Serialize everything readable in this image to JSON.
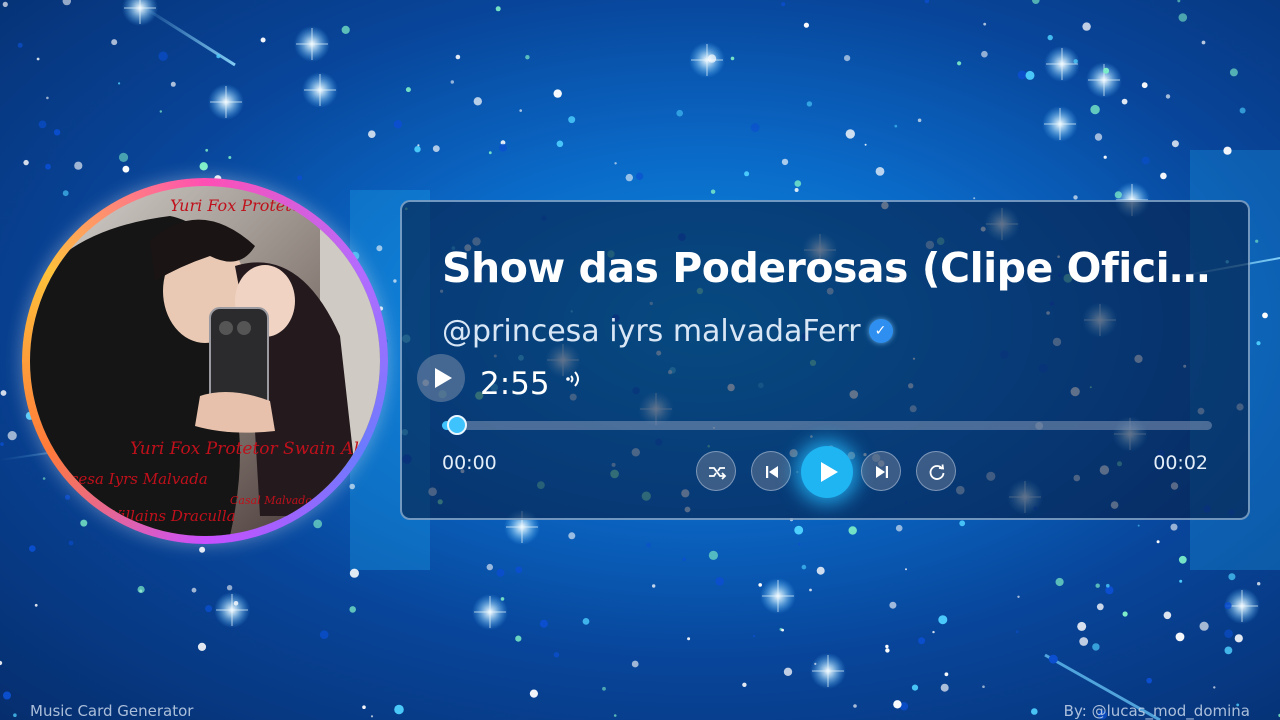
{
  "track": {
    "title": "Show das Poderosas (Clipe Oficial...",
    "artist": "@princesa iyrs malvadaFerr",
    "verified_icon": "✓",
    "duration": "2:55",
    "current_time": "00:00",
    "end_time": "00:02",
    "progress": 0.02
  },
  "icons": {
    "mini_play": "play-icon",
    "volume": "volume-icon",
    "shuffle": "shuffle-icon",
    "previous": "skip-previous-icon",
    "play": "play-icon",
    "next": "skip-next-icon",
    "repeat": "repeat-icon",
    "verified": "verified-badge-icon"
  },
  "colors": {
    "accent": "#3ec3ff",
    "play_button": "#1fb4f2",
    "verified": "#2e8ff0"
  },
  "footer": {
    "left": "Music Card Generator",
    "right": "By: @lucas_mod_domina"
  }
}
